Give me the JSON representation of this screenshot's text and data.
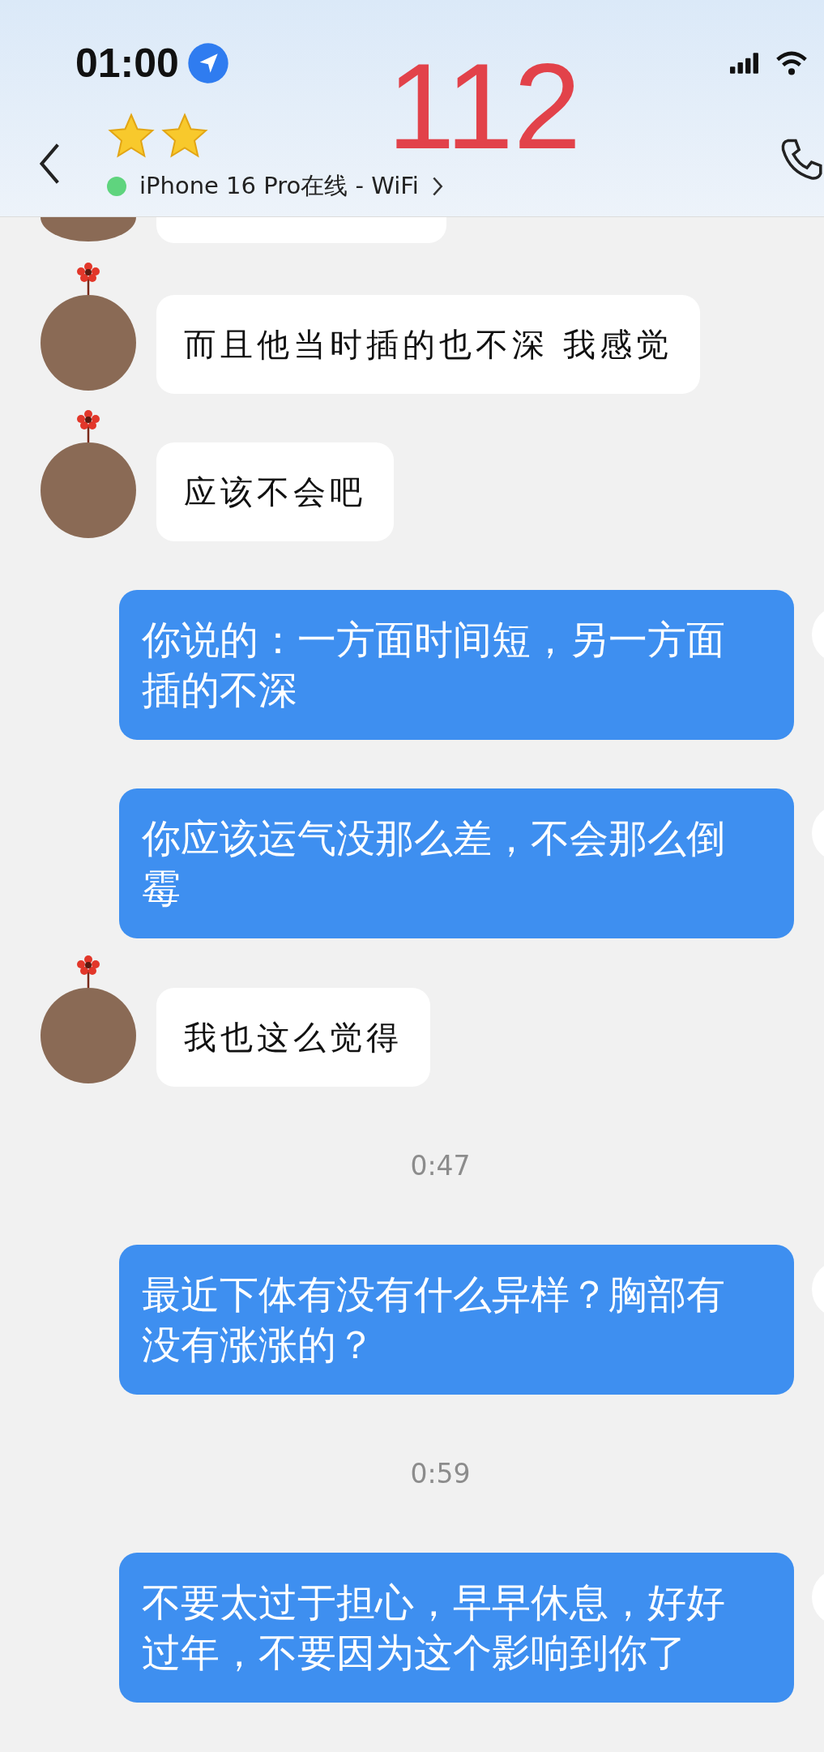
{
  "status_bar": {
    "time": "01:00"
  },
  "header": {
    "title": "112",
    "device_status": "iPhone 16 Pro在线 - WiFi",
    "online": true
  },
  "messages": [
    {
      "kind": "incoming",
      "text": "而且他当时插的也不深 我感觉"
    },
    {
      "kind": "incoming",
      "text": "应该不会吧"
    },
    {
      "kind": "outgoing",
      "text": "你说的：一方面时间短，另一方面插的不深"
    },
    {
      "kind": "outgoing",
      "text": "你应该运气没那么差，不会那么倒霉"
    },
    {
      "kind": "incoming",
      "text": "我也这么觉得"
    },
    {
      "kind": "time",
      "text": "0:47"
    },
    {
      "kind": "outgoing",
      "text": "最近下体有没有什么异样？胸部有没有涨涨的？"
    },
    {
      "kind": "time",
      "text": "0:59"
    },
    {
      "kind": "outgoing",
      "text": "不要太过于担心，早早休息，好好过年，不要因为这个影响到你了"
    }
  ]
}
